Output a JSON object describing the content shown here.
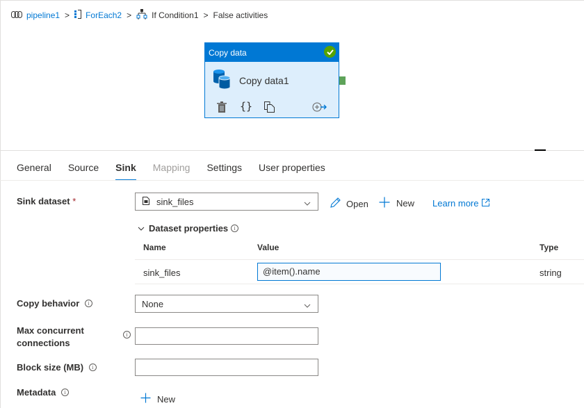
{
  "breadcrumb": {
    "items": [
      {
        "label": "pipeline1",
        "icon": "pipeline-icon",
        "link": true
      },
      {
        "label": "ForEach2",
        "icon": "foreach-icon",
        "link": true
      },
      {
        "label": "If Condition1",
        "icon": "if-condition-icon",
        "link": false
      },
      {
        "label": "False activities",
        "icon": null,
        "link": false
      }
    ],
    "separator": ">"
  },
  "activity": {
    "type_label": "Copy data",
    "name": "Copy data1",
    "status": "succeeded",
    "icon": "copy-data-icon",
    "actions": [
      "delete-icon",
      "code-icon",
      "clone-icon",
      "add-output-icon"
    ]
  },
  "tabs": [
    {
      "label": "General",
      "state": "normal"
    },
    {
      "label": "Source",
      "state": "normal"
    },
    {
      "label": "Sink",
      "state": "active"
    },
    {
      "label": "Mapping",
      "state": "disabled"
    },
    {
      "label": "Settings",
      "state": "normal"
    },
    {
      "label": "User properties",
      "state": "normal"
    }
  ],
  "sink": {
    "dataset_label": "Sink dataset",
    "required_mark": "*",
    "dataset_value": "sink_files",
    "open_label": "Open",
    "new_label": "New",
    "learn_more_label": "Learn more",
    "dataset_properties_label": "Dataset properties",
    "table": {
      "headers": [
        "Name",
        "Value",
        "Type"
      ],
      "rows": [
        {
          "name": "sink_files",
          "value": "@item().name",
          "type": "string"
        }
      ]
    },
    "copy_behavior_label": "Copy behavior",
    "copy_behavior_value": "None",
    "max_conn_label_line1": "Max concurrent",
    "max_conn_label_line2": "connections",
    "max_conn_value": "",
    "block_size_label": "Block size (MB)",
    "block_size_value": "",
    "metadata_label": "Metadata",
    "metadata_new_label": "New",
    "info_glyph": "i"
  },
  "colors": {
    "accent": "#0078d4",
    "success": "#57a300",
    "activity_bg": "#ddeefc",
    "disabled_text": "#a19f9d"
  }
}
